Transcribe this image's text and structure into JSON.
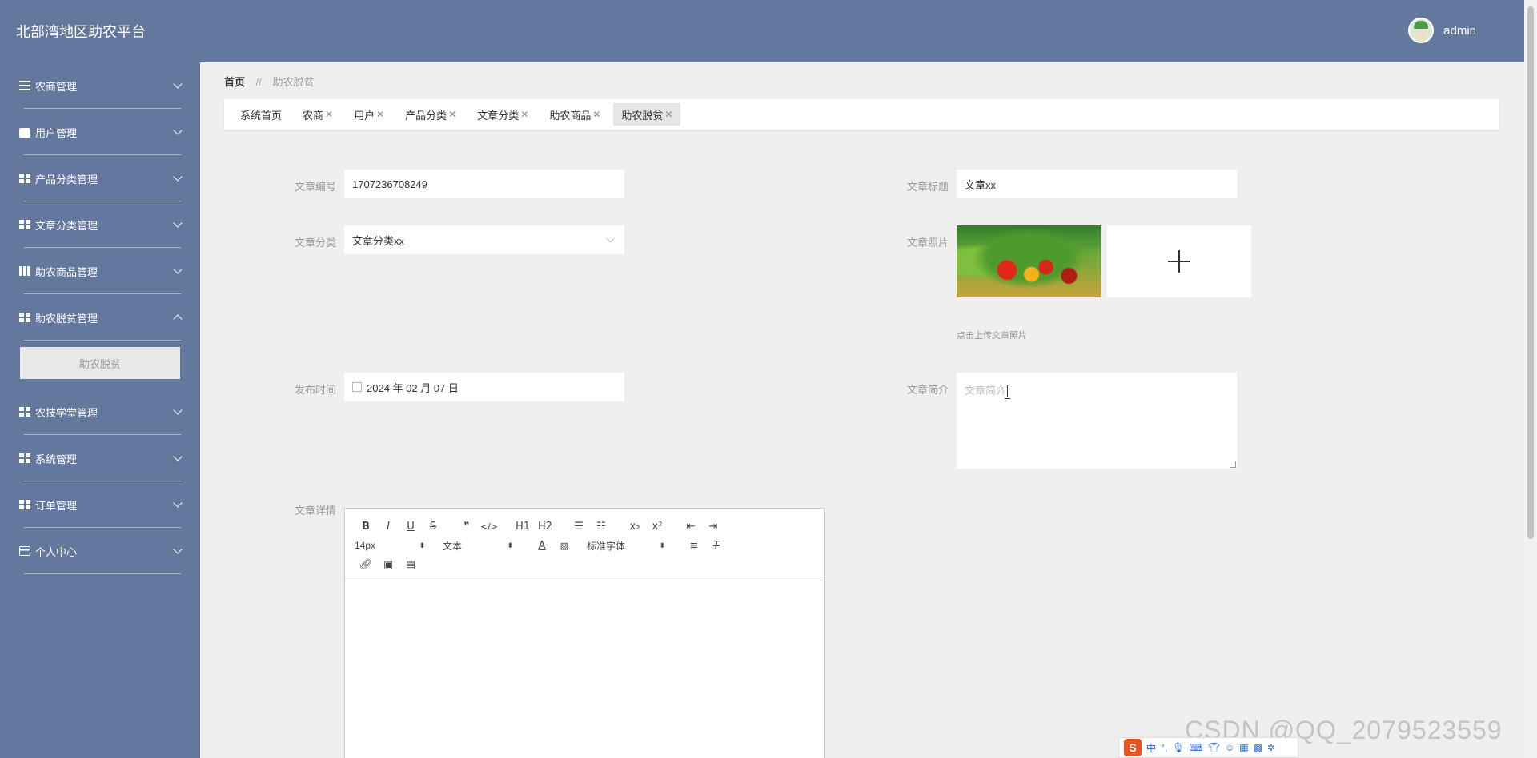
{
  "app": {
    "title": "北部湾地区助农平台"
  },
  "user": {
    "name": "admin"
  },
  "sidebar": {
    "items": [
      {
        "label": "农商管理",
        "icon": "list-icon"
      },
      {
        "label": "用户管理",
        "icon": "briefcase-icon"
      },
      {
        "label": "产品分类管理",
        "icon": "grid-icon"
      },
      {
        "label": "文章分类管理",
        "icon": "grid-icon"
      },
      {
        "label": "助农商品管理",
        "icon": "book-icon"
      },
      {
        "label": "助农脱贫管理",
        "icon": "grid-icon",
        "expanded": true,
        "sub": [
          "助农脱贫"
        ]
      },
      {
        "label": "农技学堂管理",
        "icon": "grid-icon"
      },
      {
        "label": "系统管理",
        "icon": "grid-icon"
      },
      {
        "label": "订单管理",
        "icon": "grid-icon"
      },
      {
        "label": "个人中心",
        "icon": "card-icon"
      }
    ]
  },
  "breadcrumb": {
    "home": "首页",
    "separator": "//",
    "current": "助农脱贫"
  },
  "tabs": [
    {
      "label": "系统首页",
      "closable": false
    },
    {
      "label": "农商",
      "closable": true
    },
    {
      "label": "用户",
      "closable": true
    },
    {
      "label": "产品分类",
      "closable": true
    },
    {
      "label": "文章分类",
      "closable": true
    },
    {
      "label": "助农商品",
      "closable": true
    },
    {
      "label": "助农脱贫",
      "closable": true,
      "active": true
    }
  ],
  "form": {
    "article_no": {
      "label": "文章编号",
      "value": "1707236708249"
    },
    "article_title": {
      "label": "文章标题",
      "value": "文章xx"
    },
    "article_category": {
      "label": "文章分类",
      "value": "文章分类xx"
    },
    "article_photo": {
      "label": "文章照片",
      "hint": "点击上传文章照片"
    },
    "publish_time": {
      "label": "发布时间",
      "value": "2024 年 02 月 07 日"
    },
    "article_summary": {
      "label": "文章简介",
      "placeholder": "文章简介"
    },
    "article_detail": {
      "label": "文章详情"
    }
  },
  "editor": {
    "row1": [
      "B",
      "I",
      "U",
      "S",
      "❞",
      "</>",
      "H1",
      "H2",
      "ol",
      "ul",
      "x₂",
      "x²",
      "outdent",
      "indent"
    ],
    "font_size": "14px",
    "heading": "文本",
    "font_family": "标准字体"
  },
  "ime": {
    "logo": "S",
    "mode": "中"
  },
  "watermark": "CSDN @QQ_2079523559"
}
